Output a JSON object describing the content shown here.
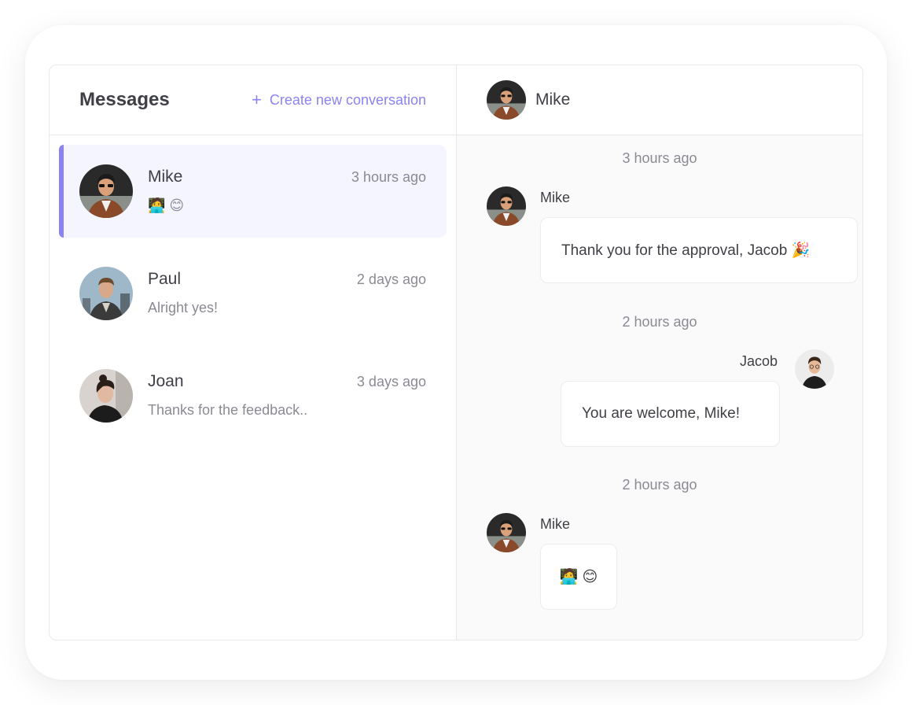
{
  "sidebar": {
    "title": "Messages",
    "create_label": "Create new conversation",
    "create_icon": "plus-icon",
    "conversations": [
      {
        "name": "Mike",
        "time": "3 hours ago",
        "preview": "🧑‍💻 😊",
        "active": true
      },
      {
        "name": "Paul",
        "time": "2 days ago",
        "preview": "Alright yes!",
        "active": false
      },
      {
        "name": "Joan",
        "time": "3 days ago",
        "preview": "Thanks for the feedback..",
        "active": false
      }
    ]
  },
  "chat": {
    "contact_name": "Mike",
    "messages": [
      {
        "timestamp": "3 hours ago",
        "sender": "Mike",
        "text": "Thank you for the approval, Jacob 🎉",
        "outgoing": false
      },
      {
        "timestamp": "2 hours ago",
        "sender": "Jacob",
        "text": "You are welcome, Mike!",
        "outgoing": true
      },
      {
        "timestamp": "2 hours ago",
        "sender": "Mike",
        "text": "🧑‍💻 😊",
        "outgoing": false
      }
    ]
  },
  "colors": {
    "accent": "#8b83f2",
    "active_bg": "#f4f5fe",
    "chat_bg": "#fafafa"
  }
}
